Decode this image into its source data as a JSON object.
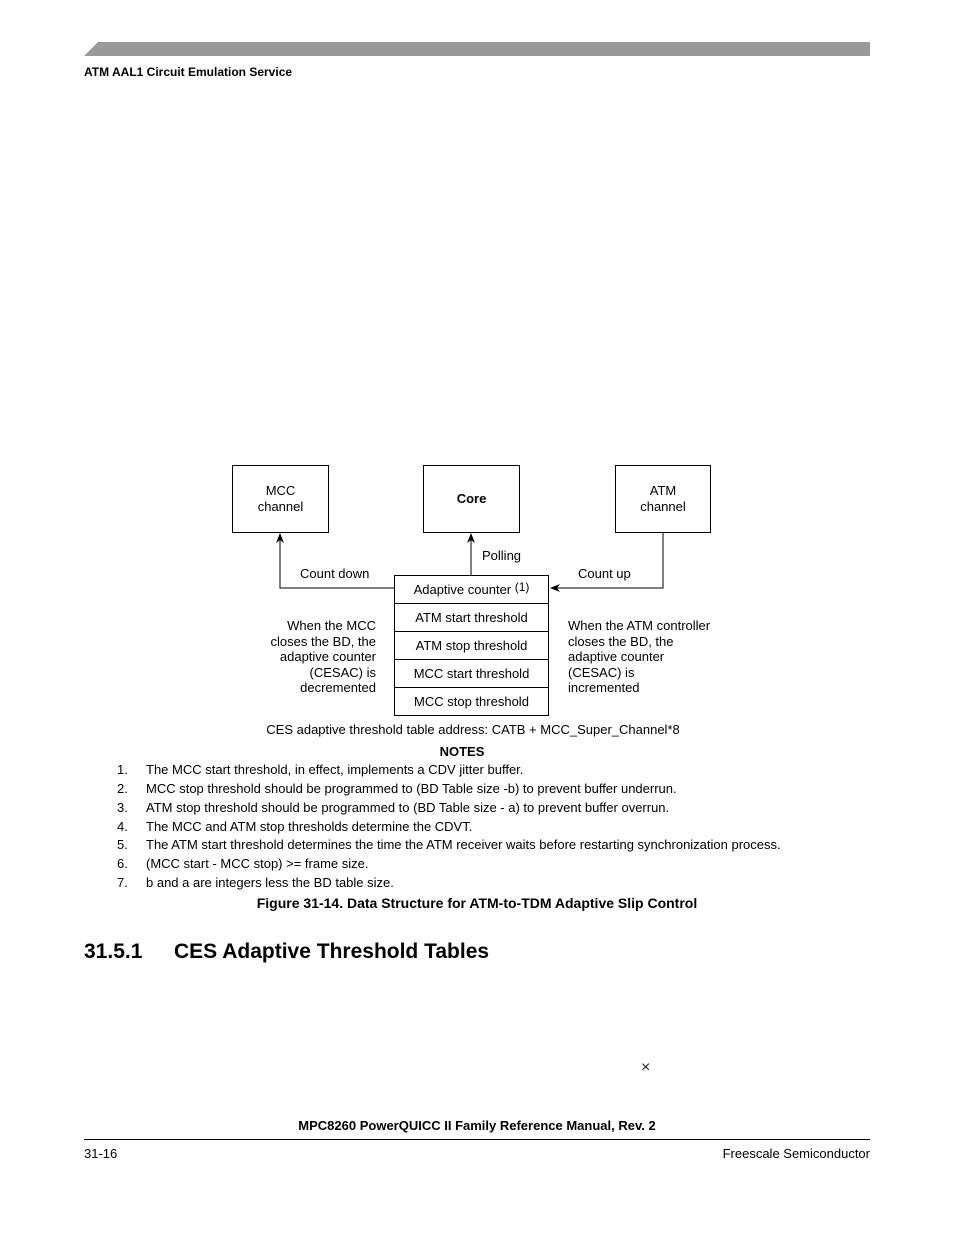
{
  "header": {
    "running_head": "ATM AAL1 Circuit Emulation Service",
    "bar_color": "#999999"
  },
  "figure": {
    "boxes": {
      "mcc_channel": [
        "MCC",
        "channel"
      ],
      "core": "Core",
      "atm_channel": [
        "ATM",
        "channel"
      ]
    },
    "arrow_labels": {
      "count_down": "Count down",
      "polling": "Polling",
      "count_up": "Count up"
    },
    "table_rows": [
      {
        "label": "Adaptive counter",
        "note": "(1)"
      },
      {
        "label": "ATM start threshold"
      },
      {
        "label": "ATM stop threshold"
      },
      {
        "label": "MCC start threshold"
      },
      {
        "label": "MCC stop threshold"
      }
    ],
    "left_annotation": [
      "When the MCC",
      "closes the BD, the",
      "adaptive counter",
      "(CESAC) is",
      "decremented"
    ],
    "right_annotation": [
      "When the ATM controller",
      "closes the BD, the",
      "adaptive counter",
      "(CESAC) is",
      "incremented"
    ],
    "address_line": "CES adaptive threshold table address: CATB + MCC_Super_Channel*8",
    "notes_heading": "NOTES",
    "notes": [
      {
        "num": "1.",
        "text": "The MCC start threshold, in effect, implements a CDV jitter buffer."
      },
      {
        "num": "2.",
        "text": "MCC stop threshold should be programmed to (BD Table size -b) to prevent buffer underrun."
      },
      {
        "num": "3.",
        "text": "ATM stop threshold should be programmed to (BD Table size - a) to prevent buffer overrun."
      },
      {
        "num": "4.",
        "text": "The MCC and ATM stop thresholds determine the CDVT."
      },
      {
        "num": "5.",
        "text": "The ATM start threshold determines the time the ATM receiver waits before restarting synchronization process."
      },
      {
        "num": "6.",
        "text": "(MCC start - MCC stop) >= frame size."
      },
      {
        "num": "7.",
        "text": "b and a are integers less the BD table size."
      }
    ],
    "caption": "Figure 31-14. Data Structure for ATM-to-TDM Adaptive Slip Control"
  },
  "section": {
    "number": "31.5.1",
    "title": "CES Adaptive Threshold Tables"
  },
  "stray_mark": "×",
  "footer": {
    "title": "MPC8260 PowerQUICC II Family Reference Manual, Rev. 2",
    "page_number": "31-16",
    "publisher": "Freescale Semiconductor"
  }
}
